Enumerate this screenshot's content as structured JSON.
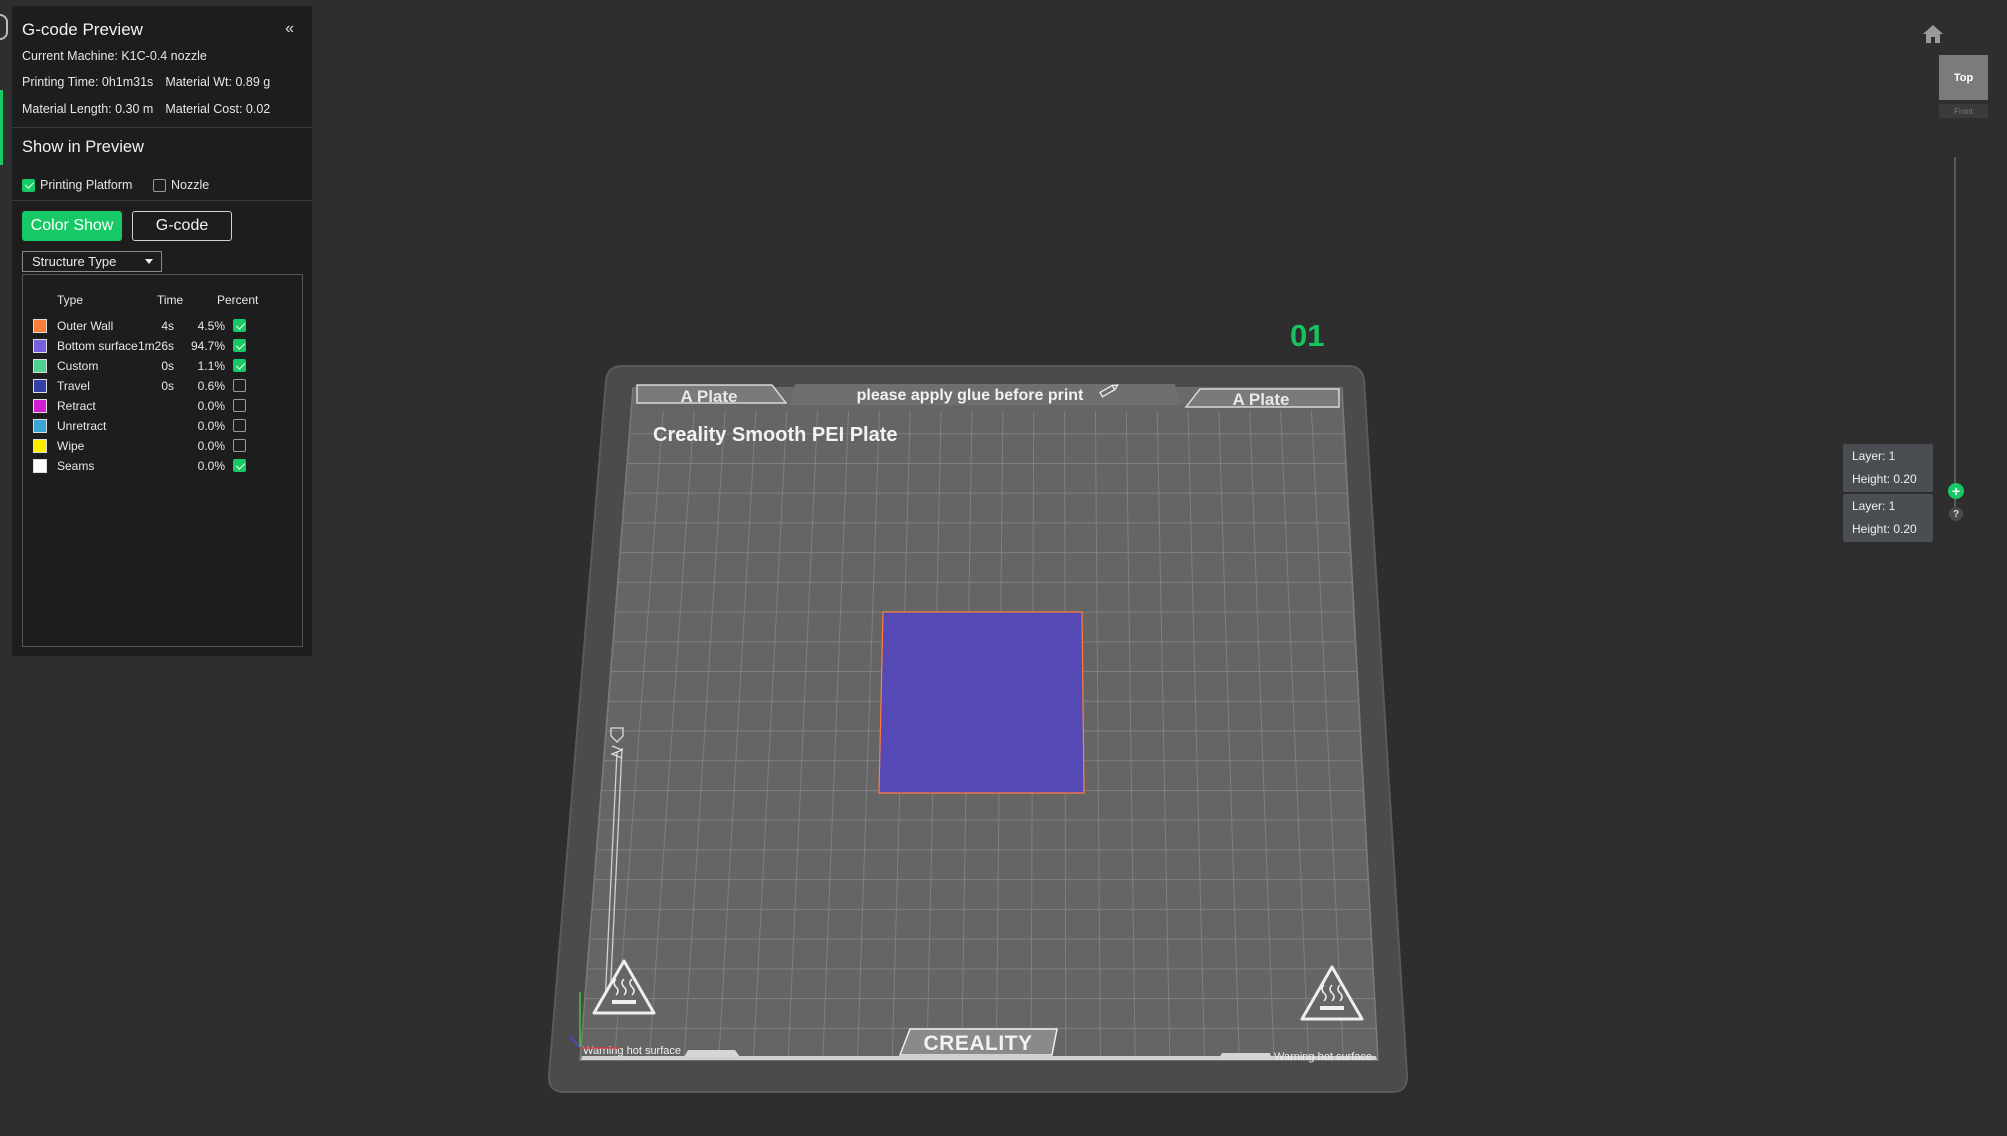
{
  "panel": {
    "title": "G-code Preview",
    "collapse_icon": "«",
    "current_machine": "Current Machine: K1C-0.4 nozzle",
    "printing_time": "Printing Time: 0h1m31s",
    "material_wt": "Material Wt: 0.89 g",
    "material_length": "Material Length: 0.30 m",
    "material_cost": "Material Cost: 0.02"
  },
  "show_in_preview": {
    "title": "Show in Preview",
    "printing_platform": {
      "label": "Printing Platform",
      "checked": true
    },
    "nozzle": {
      "label": "Nozzle",
      "checked": false
    }
  },
  "modes": {
    "color_show": "Color Show",
    "gcode": "G-code"
  },
  "structure": {
    "selected": "Structure Type",
    "headers": {
      "type": "Type",
      "time": "Time",
      "percent": "Percent"
    },
    "rows": [
      {
        "name": "Outer Wall",
        "time": "4s",
        "percent": "4.5%",
        "color": "#ff7f3a",
        "checked": true
      },
      {
        "name": "Bottom surface",
        "time": "1m26s",
        "percent": "94.7%",
        "color": "#7a5fe0",
        "checked": true
      },
      {
        "name": "Custom",
        "time": "0s",
        "percent": "1.1%",
        "color": "#4fd08f",
        "checked": true
      },
      {
        "name": "Travel",
        "time": "0s",
        "percent": "0.6%",
        "color": "#3340a8",
        "checked": false
      },
      {
        "name": "Retract",
        "time": "",
        "percent": "0.0%",
        "color": "#d21fd2",
        "checked": false
      },
      {
        "name": "Unretract",
        "time": "",
        "percent": "0.0%",
        "color": "#3aa6d6",
        "checked": false
      },
      {
        "name": "Wipe",
        "time": "",
        "percent": "0.0%",
        "color": "#ffee00",
        "checked": false
      },
      {
        "name": "Seams",
        "time": "",
        "percent": "0.0%",
        "color": "#ffffff",
        "checked": true
      }
    ]
  },
  "plate": {
    "number": "01",
    "left_tab": "A Plate",
    "right_tab": "A Plate",
    "note": "please apply glue before print",
    "name": "Creality Smooth PEI Plate",
    "brand": "CREALITY",
    "warning": "Warning hot surface"
  },
  "view": {
    "cube_top": "Top",
    "cube_front": "Front"
  },
  "layers": {
    "upper": {
      "layer": "Layer: 1",
      "height": "Height: 0.20"
    },
    "lower": {
      "layer": "Layer: 1",
      "height": "Height: 0.20"
    }
  },
  "colors": {
    "accent": "#17c964",
    "print_fill": "#5449b5",
    "print_edge": "#ff7f3a"
  }
}
